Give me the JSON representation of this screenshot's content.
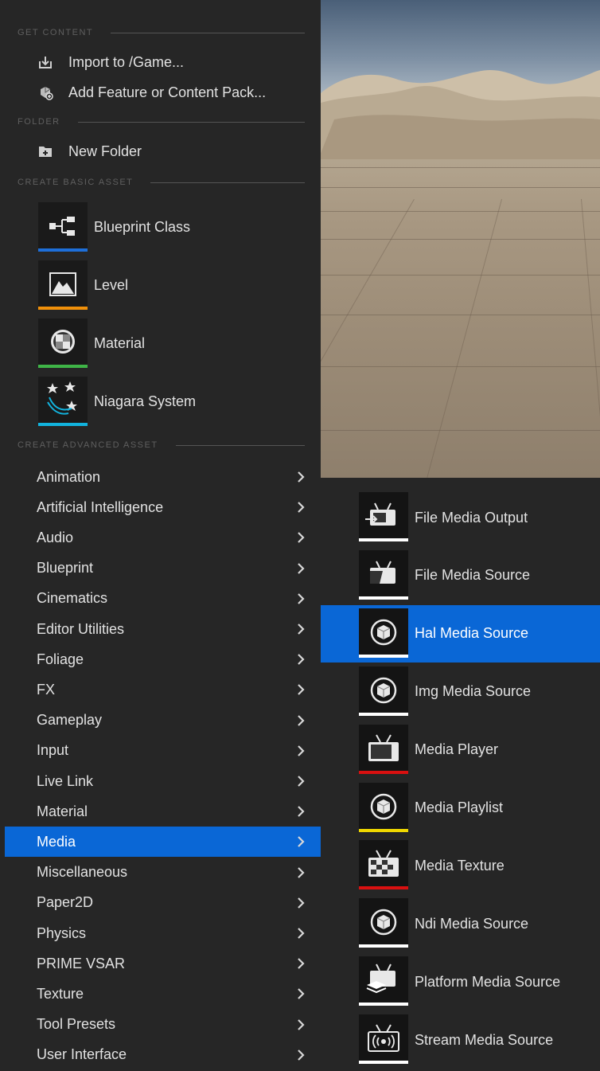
{
  "colors": {
    "selection": "#0a67d6",
    "menu_bg": "#262626",
    "blueprint": "#1e6fd9",
    "level": "#f0900a",
    "material": "#3fb447",
    "niagara": "#12b3de",
    "white": "#ffffff",
    "red": "#d91010",
    "yellow": "#f0d800"
  },
  "get_content": {
    "heading": "GET CONTENT",
    "items": [
      {
        "label": "Import to /Game...",
        "icon": "import-icon"
      },
      {
        "label": "Add Feature or Content Pack...",
        "icon": "content-pack-icon"
      }
    ]
  },
  "folder": {
    "heading": "FOLDER",
    "new_folder": "New Folder",
    "icon": "folder-add-icon"
  },
  "basic": {
    "heading": "CREATE BASIC ASSET",
    "items": [
      {
        "label": "Blueprint Class",
        "icon": "blueprint-icon",
        "accent": "#1e6fd9"
      },
      {
        "label": "Level",
        "icon": "level-icon",
        "accent": "#f0900a"
      },
      {
        "label": "Material",
        "icon": "material-icon",
        "accent": "#3fb447"
      },
      {
        "label": "Niagara System",
        "icon": "niagara-icon",
        "accent": "#12b3de"
      }
    ]
  },
  "advanced": {
    "heading": "CREATE ADVANCED ASSET",
    "selected": "Media",
    "items": [
      "Animation",
      "Artificial Intelligence",
      "Audio",
      "Blueprint",
      "Cinematics",
      "Editor Utilities",
      "Foliage",
      "FX",
      "Gameplay",
      "Input",
      "Live Link",
      "Material",
      "Media",
      "Miscellaneous",
      "Paper2D",
      "Physics",
      "PRIME VSAR",
      "Texture",
      "Tool Presets",
      "User Interface"
    ]
  },
  "media_submenu": {
    "selected": "Hal Media Source",
    "items": [
      {
        "label": "File Media Output",
        "icon": "tv-output-icon",
        "accent": "#ffffff"
      },
      {
        "label": "File Media Source",
        "icon": "tv-source-icon",
        "accent": "#ffffff"
      },
      {
        "label": "Hal Media Source",
        "icon": "cube-circle-icon",
        "accent": "#ffffff"
      },
      {
        "label": "Img Media Source",
        "icon": "cube-circle-icon",
        "accent": "#ffffff"
      },
      {
        "label": "Media Player",
        "icon": "tv-icon",
        "accent": "#d91010"
      },
      {
        "label": "Media Playlist",
        "icon": "cube-circle-icon",
        "accent": "#f0d800"
      },
      {
        "label": "Media Texture",
        "icon": "tv-checker-icon",
        "accent": "#d91010"
      },
      {
        "label": "Ndi Media Source",
        "icon": "cube-circle-icon",
        "accent": "#ffffff"
      },
      {
        "label": "Platform Media Source",
        "icon": "tv-platform-icon",
        "accent": "#ffffff"
      },
      {
        "label": "Stream Media Source",
        "icon": "tv-stream-icon",
        "accent": "#ffffff"
      }
    ]
  }
}
